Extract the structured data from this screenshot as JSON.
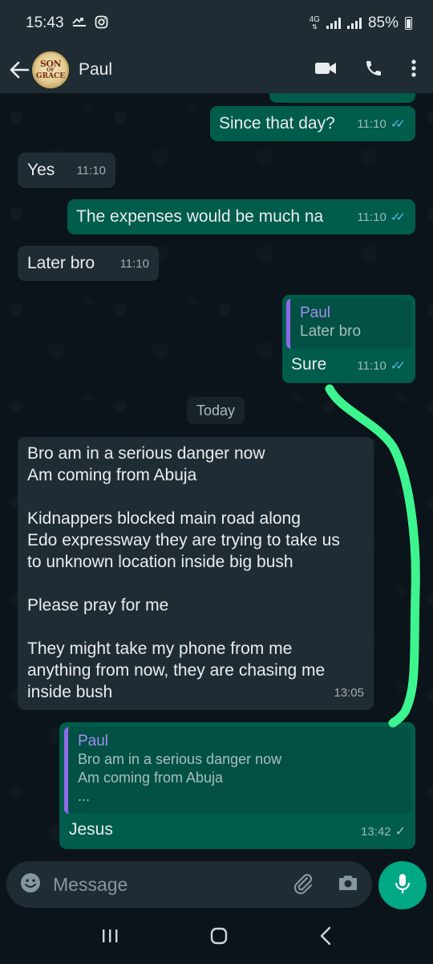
{
  "status_bar": {
    "time": "15:43",
    "network": "4G",
    "battery": "85%"
  },
  "header": {
    "contact_name": "Paul",
    "avatar_text": [
      "SON",
      "OF",
      "GRACE"
    ]
  },
  "messages": [
    {
      "direction": "out",
      "text": "Since that day?",
      "time": "11:10",
      "status": "read"
    },
    {
      "direction": "in",
      "text": "Yes",
      "time": "11:10"
    },
    {
      "direction": "out",
      "text": "The expenses would be much na",
      "time": "11:10",
      "status": "read"
    },
    {
      "direction": "in",
      "text": "Later bro",
      "time": "11:10"
    },
    {
      "direction": "out",
      "text": "Sure",
      "time": "11:10",
      "status": "read",
      "quote": {
        "author": "Paul",
        "text": "Later bro"
      }
    },
    {
      "direction": "in",
      "text": "Bro am in a serious danger now\n Am coming from Abuja\n\nKidnappers blocked main road  along\nEdo expressway they are trying to take us\nto unknown location inside big bush\n\nPlease pray for me\n\nThey might take my phone from me\nanything from now, they are chasing me\ninside bush",
      "time": "13:05"
    },
    {
      "direction": "out",
      "text": "Jesus",
      "time": "13:42",
      "status": "sent",
      "quote": {
        "author": "Paul",
        "text": "Bro am in a serious danger now\n Am coming from Abuja\n..."
      }
    }
  ],
  "date_separator": "Today",
  "composer": {
    "placeholder": "Message"
  },
  "colors": {
    "background": "#0b141a",
    "header": "#1f2c33",
    "incoming_bubble": "#202c33",
    "outgoing_bubble": "#005c4b",
    "accent": "#00a884",
    "read_ticks": "#53bdeb",
    "annotation_stroke": "#3df58f"
  },
  "icons": [
    "back-arrow-icon",
    "video-call-icon",
    "voice-call-icon",
    "more-vert-icon",
    "emoji-icon",
    "attach-icon",
    "camera-icon",
    "mic-icon",
    "nav-recents-icon",
    "nav-home-icon",
    "nav-back-icon"
  ]
}
